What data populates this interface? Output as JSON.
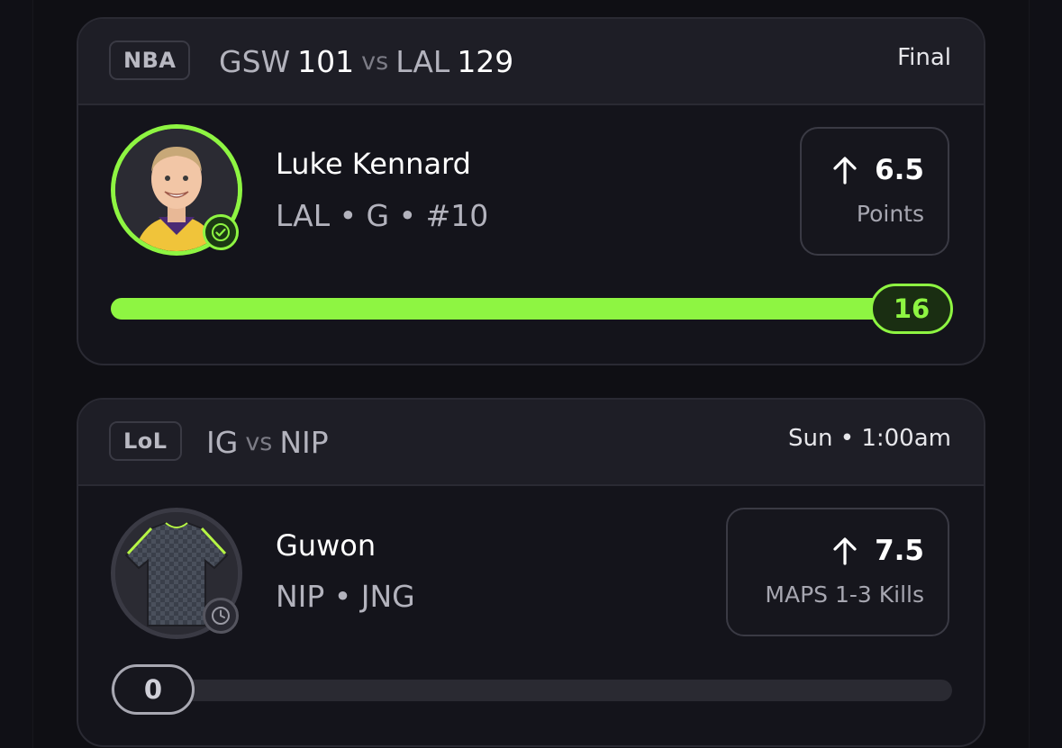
{
  "cards": [
    {
      "league": "NBA",
      "matchup": {
        "team_a": "GSW",
        "score_a": "101",
        "vs": "vs",
        "team_b": "LAL",
        "score_b": "129"
      },
      "status": "Final",
      "player": {
        "name": "Luke Kennard",
        "meta": "LAL • G • #10",
        "status_icon": "check-icon"
      },
      "line": {
        "direction_icon": "arrow-up-icon",
        "value": "6.5",
        "stat": "Points"
      },
      "progress": {
        "current": "16",
        "fraction": 1.0,
        "color": "#8ef542"
      }
    },
    {
      "league": "LoL",
      "matchup": {
        "team_a": "IG",
        "score_a": "",
        "vs": "vs",
        "team_b": "NIP",
        "score_b": ""
      },
      "status": "Sun • 1:00am",
      "player": {
        "name": "Guwon",
        "meta": "NIP • JNG",
        "status_icon": "clock-icon"
      },
      "line": {
        "direction_icon": "arrow-up-icon",
        "value": "7.5",
        "stat": "MAPS 1-3 Kills"
      },
      "progress": {
        "current": "0",
        "fraction": 0.0,
        "color": "#a8a8b2"
      }
    }
  ],
  "colors": {
    "accent_green": "#8ef542",
    "card_bg": "#14141b",
    "header_bg": "#1e1e26"
  }
}
